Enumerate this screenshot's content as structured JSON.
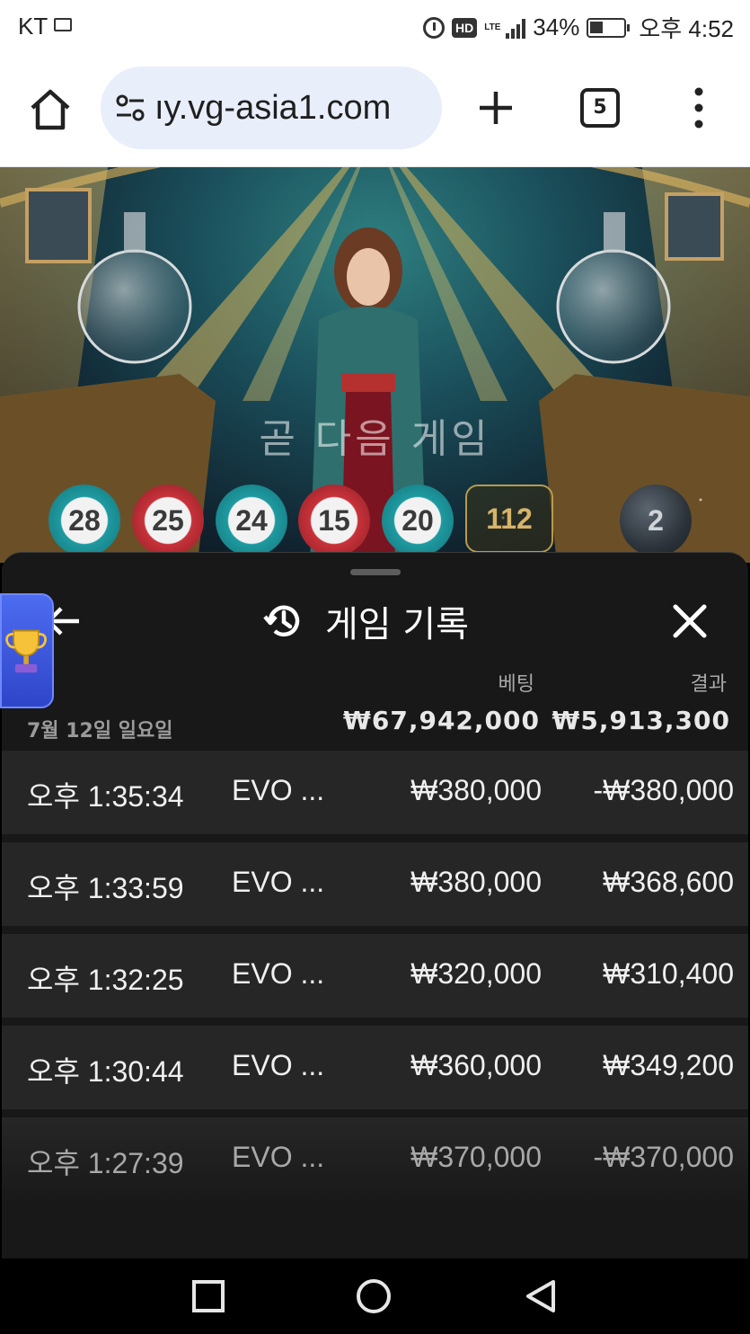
{
  "status_bar": {
    "carrier": "KT",
    "battery": "34%",
    "time": "오후 4:52",
    "hd_badge": "HD",
    "network": "LTE"
  },
  "browser": {
    "url": "ıy.vg-asia1.com",
    "tab_count": "5"
  },
  "scene": {
    "status_text": "곧 다음 게임",
    "balls": [
      {
        "number": "28",
        "color": "teal"
      },
      {
        "number": "25",
        "color": "red"
      },
      {
        "number": "24",
        "color": "teal"
      },
      {
        "number": "15",
        "color": "red"
      },
      {
        "number": "20",
        "color": "teal"
      }
    ],
    "sum": "112",
    "extra_ball": "2"
  },
  "history": {
    "title": "게임 기록",
    "col_bet": "베팅",
    "col_result": "결과",
    "date": "7월 12일 일요일",
    "total_bet": "₩67,942,000",
    "total_result": "₩5,913,300",
    "rows": [
      {
        "time": "오후 1:35:34",
        "game": "EVO ...",
        "bet": "₩380,000",
        "result": "-₩380,000"
      },
      {
        "time": "오후 1:33:59",
        "game": "EVO ...",
        "bet": "₩380,000",
        "result": "₩368,600"
      },
      {
        "time": "오후 1:32:25",
        "game": "EVO ...",
        "bet": "₩320,000",
        "result": "₩310,400"
      },
      {
        "time": "오후 1:30:44",
        "game": "EVO ...",
        "bet": "₩360,000",
        "result": "₩349,200"
      },
      {
        "time": "오후 1:27:39",
        "game": "EVO ...",
        "bet": "₩370,000",
        "result": "-₩370,000"
      }
    ]
  },
  "colors": {
    "panel_bg": "#181818",
    "row_bg": "#262626",
    "accent_gold": "#d6b46a",
    "trophy_tab": "#3b55dd"
  }
}
